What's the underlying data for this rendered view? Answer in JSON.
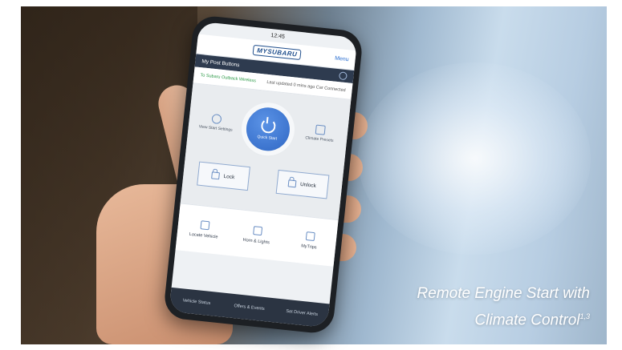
{
  "status_bar": {
    "time": "12:45"
  },
  "app_header": {
    "brand": "MYSUBARU",
    "menu_label": "Menu"
  },
  "shortcut_bar": {
    "title": "My Post Buttons"
  },
  "vehicle": {
    "name": "To Subaru Outback Wireless",
    "status": "Last updated 0 mins ago Car Connected"
  },
  "controls": {
    "start_label": "Quick Start",
    "left_label": "View Start Settings",
    "right_label": "Climate Presets",
    "lock_label": "Lock",
    "unlock_label": "Unlock"
  },
  "quick_actions": [
    {
      "label": "Locate Vehicle",
      "icon": "location-icon"
    },
    {
      "label": "Horn & Lights",
      "icon": "horn-icon"
    },
    {
      "label": "MyTrips",
      "icon": "trips-icon"
    }
  ],
  "bottom_nav": [
    {
      "label": "Vehicle Status"
    },
    {
      "label": "Offers & Events"
    },
    {
      "label": "Set Driver Alerts"
    }
  ],
  "caption": {
    "line1": "Remote Engine Start with",
    "line2": "Climate Control",
    "superscript": "1,3"
  },
  "colors": {
    "accent": "#2f67c4",
    "status_green": "#2f9b4a",
    "nav_dark": "#2b3442"
  }
}
